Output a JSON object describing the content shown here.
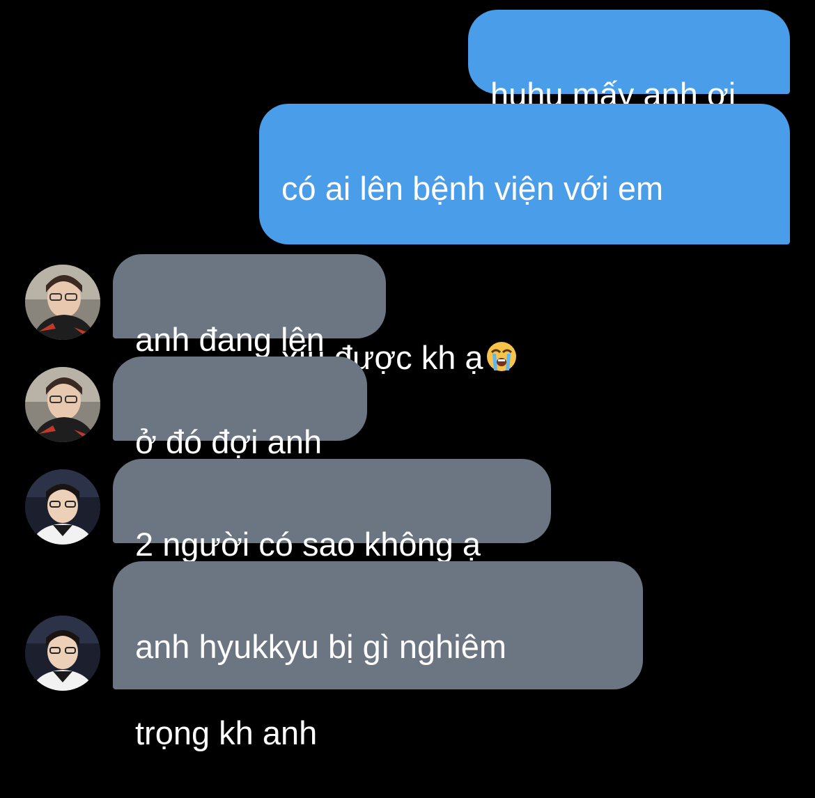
{
  "messages": [
    {
      "direction": "outgoing",
      "text": "huhu mấy anh ơi"
    },
    {
      "direction": "outgoing",
      "text_line1": "có ai lên bệnh viện với em",
      "text_line2": "xíu được kh ạ",
      "emoji": "loudly-crying-face"
    },
    {
      "direction": "incoming",
      "sender_avatar": "avatar-1",
      "text": "anh đang lên"
    },
    {
      "direction": "incoming",
      "sender_avatar": "avatar-1",
      "text": "ở đó đợi anh"
    },
    {
      "direction": "incoming",
      "sender_avatar": "avatar-2",
      "text": "2 người có sao không ạ"
    },
    {
      "direction": "incoming",
      "sender_avatar": "avatar-2",
      "text_line1": "anh hyukkyu bị gì nghiêm",
      "text_line2": "trọng kh anh"
    }
  ],
  "colors": {
    "background": "#000000",
    "outgoing_bubble": "#4a9de9",
    "incoming_bubble": "#6c7683",
    "text": "#ffffff"
  }
}
